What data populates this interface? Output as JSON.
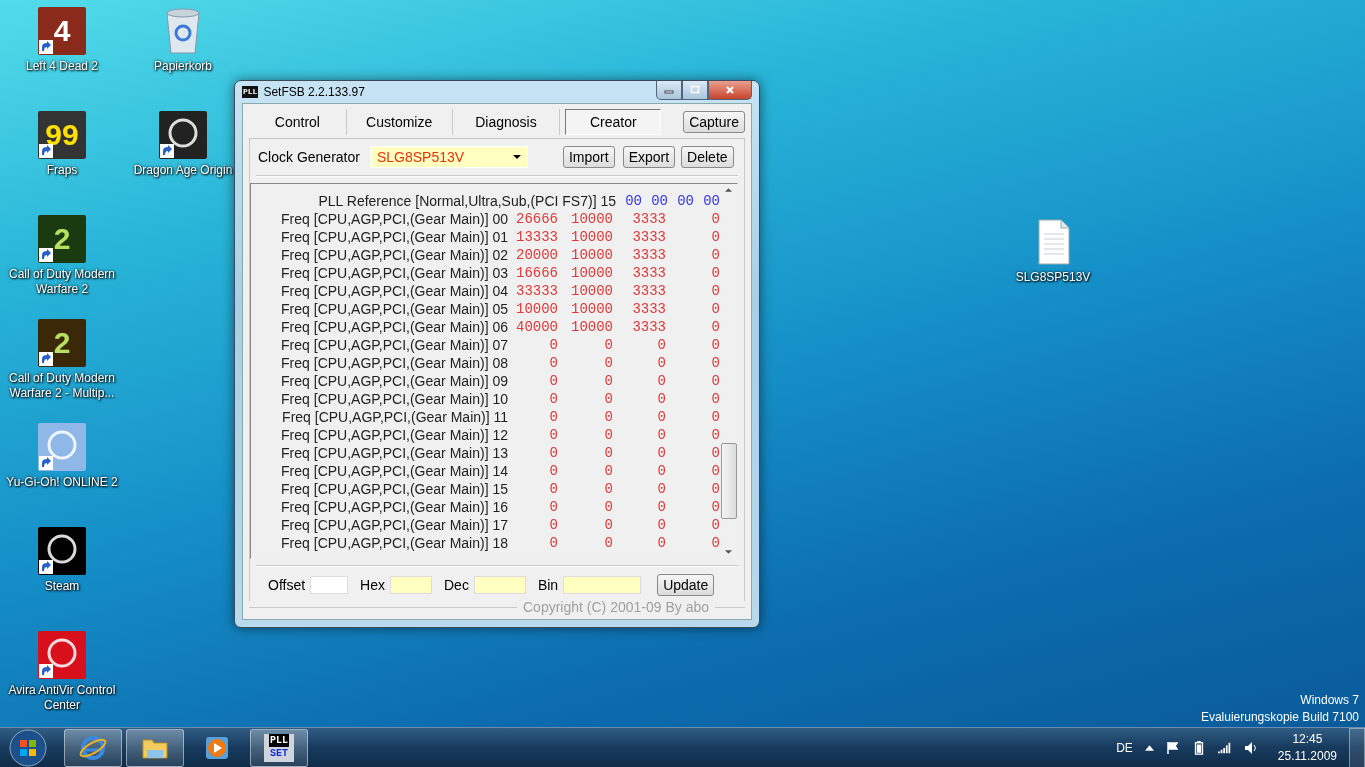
{
  "desktop": {
    "icons": [
      {
        "label": "Left 4 Dead 2",
        "kind": "app",
        "badge": "4"
      },
      {
        "label": "Papierkorb",
        "kind": "bin"
      },
      {
        "label": "Fraps",
        "kind": "app",
        "badge": "99"
      },
      {
        "label": "Dragon Age Origin",
        "kind": "app"
      },
      {
        "label": "Call of Duty Modern Warfare 2",
        "kind": "app",
        "badge": "2"
      },
      {
        "label": "Call of Duty Modern Warfare 2 - Multip...",
        "kind": "app",
        "badge": "2"
      },
      {
        "label": "Yu-Gi-Oh! ONLINE 2",
        "kind": "app"
      },
      {
        "label": "Steam",
        "kind": "app"
      },
      {
        "label": "Avira AntiVir Control Center",
        "kind": "app"
      },
      {
        "label": "SLG8SP513V",
        "kind": "file"
      }
    ],
    "notice": [
      "Windows 7",
      "Evaluierungskopie Build 7100"
    ]
  },
  "window": {
    "title": "SetFSB 2.2.133.97",
    "icon_text": "PLL",
    "tabs": [
      {
        "label": "Control",
        "selected": false
      },
      {
        "label": "Customize",
        "selected": false
      },
      {
        "label": "Diagnosis",
        "selected": false
      },
      {
        "label": "Creator",
        "selected": true
      }
    ],
    "capture_button": "Capture",
    "clock_generator": {
      "label": "Clock Generator",
      "value": "SLG8SP513V"
    },
    "buttons": [
      "Import",
      "Export",
      "Delete"
    ],
    "rows": [
      {
        "kind": "pll",
        "label": "PLL Reference [Normal,Ultra,Sub,(PCI FS7)]",
        "index": "15",
        "values": [
          "00",
          "00",
          "00",
          "00"
        ]
      },
      {
        "kind": "freq",
        "label": "Freq [CPU,AGP,PCI,(Gear Main)]",
        "index": "00",
        "values": [
          "26666",
          "10000",
          "3333",
          "0"
        ]
      },
      {
        "kind": "freq",
        "label": "Freq [CPU,AGP,PCI,(Gear Main)]",
        "index": "01",
        "values": [
          "13333",
          "10000",
          "3333",
          "0"
        ]
      },
      {
        "kind": "freq",
        "label": "Freq [CPU,AGP,PCI,(Gear Main)]",
        "index": "02",
        "values": [
          "20000",
          "10000",
          "3333",
          "0"
        ]
      },
      {
        "kind": "freq",
        "label": "Freq [CPU,AGP,PCI,(Gear Main)]",
        "index": "03",
        "values": [
          "16666",
          "10000",
          "3333",
          "0"
        ]
      },
      {
        "kind": "freq",
        "label": "Freq [CPU,AGP,PCI,(Gear Main)]",
        "index": "04",
        "values": [
          "33333",
          "10000",
          "3333",
          "0"
        ]
      },
      {
        "kind": "freq",
        "label": "Freq [CPU,AGP,PCI,(Gear Main)]",
        "index": "05",
        "values": [
          "10000",
          "10000",
          "3333",
          "0"
        ]
      },
      {
        "kind": "freq",
        "label": "Freq [CPU,AGP,PCI,(Gear Main)]",
        "index": "06",
        "values": [
          "40000",
          "10000",
          "3333",
          "0"
        ]
      },
      {
        "kind": "freq",
        "label": "Freq [CPU,AGP,PCI,(Gear Main)]",
        "index": "07",
        "values": [
          "0",
          "0",
          "0",
          "0"
        ]
      },
      {
        "kind": "freq",
        "label": "Freq [CPU,AGP,PCI,(Gear Main)]",
        "index": "08",
        "values": [
          "0",
          "0",
          "0",
          "0"
        ]
      },
      {
        "kind": "freq",
        "label": "Freq [CPU,AGP,PCI,(Gear Main)]",
        "index": "09",
        "values": [
          "0",
          "0",
          "0",
          "0"
        ]
      },
      {
        "kind": "freq",
        "label": "Freq [CPU,AGP,PCI,(Gear Main)]",
        "index": "10",
        "values": [
          "0",
          "0",
          "0",
          "0"
        ]
      },
      {
        "kind": "freq",
        "label": "Freq [CPU,AGP,PCI,(Gear Main)]",
        "index": "11",
        "values": [
          "0",
          "0",
          "0",
          "0"
        ]
      },
      {
        "kind": "freq",
        "label": "Freq [CPU,AGP,PCI,(Gear Main)]",
        "index": "12",
        "values": [
          "0",
          "0",
          "0",
          "0"
        ]
      },
      {
        "kind": "freq",
        "label": "Freq [CPU,AGP,PCI,(Gear Main)]",
        "index": "13",
        "values": [
          "0",
          "0",
          "0",
          "0"
        ]
      },
      {
        "kind": "freq",
        "label": "Freq [CPU,AGP,PCI,(Gear Main)]",
        "index": "14",
        "values": [
          "0",
          "0",
          "0",
          "0"
        ]
      },
      {
        "kind": "freq",
        "label": "Freq [CPU,AGP,PCI,(Gear Main)]",
        "index": "15",
        "values": [
          "0",
          "0",
          "0",
          "0"
        ]
      },
      {
        "kind": "freq",
        "label": "Freq [CPU,AGP,PCI,(Gear Main)]",
        "index": "16",
        "values": [
          "0",
          "0",
          "0",
          "0"
        ]
      },
      {
        "kind": "freq",
        "label": "Freq [CPU,AGP,PCI,(Gear Main)]",
        "index": "17",
        "values": [
          "0",
          "0",
          "0",
          "0"
        ]
      },
      {
        "kind": "freq",
        "label": "Freq [CPU,AGP,PCI,(Gear Main)]",
        "index": "18",
        "values": [
          "0",
          "0",
          "0",
          "0"
        ]
      }
    ],
    "fields": [
      {
        "label": "Offset",
        "kind": "plain"
      },
      {
        "label": "Hex",
        "kind": "yellow"
      },
      {
        "label": "Dec",
        "kind": "yellow"
      },
      {
        "label": "Bin",
        "kind": "yellow"
      }
    ],
    "update_button": "Update",
    "copyright": "Copyright (C) 2001-09 By abo"
  },
  "taskbar": {
    "apps": [
      {
        "running": true
      },
      {
        "running": true
      },
      {
        "running": false
      },
      {
        "running": true,
        "icon_lines": [
          "PLL",
          "SET"
        ]
      }
    ],
    "language": "DE",
    "time": "12:45",
    "date": "25.11.2009"
  }
}
